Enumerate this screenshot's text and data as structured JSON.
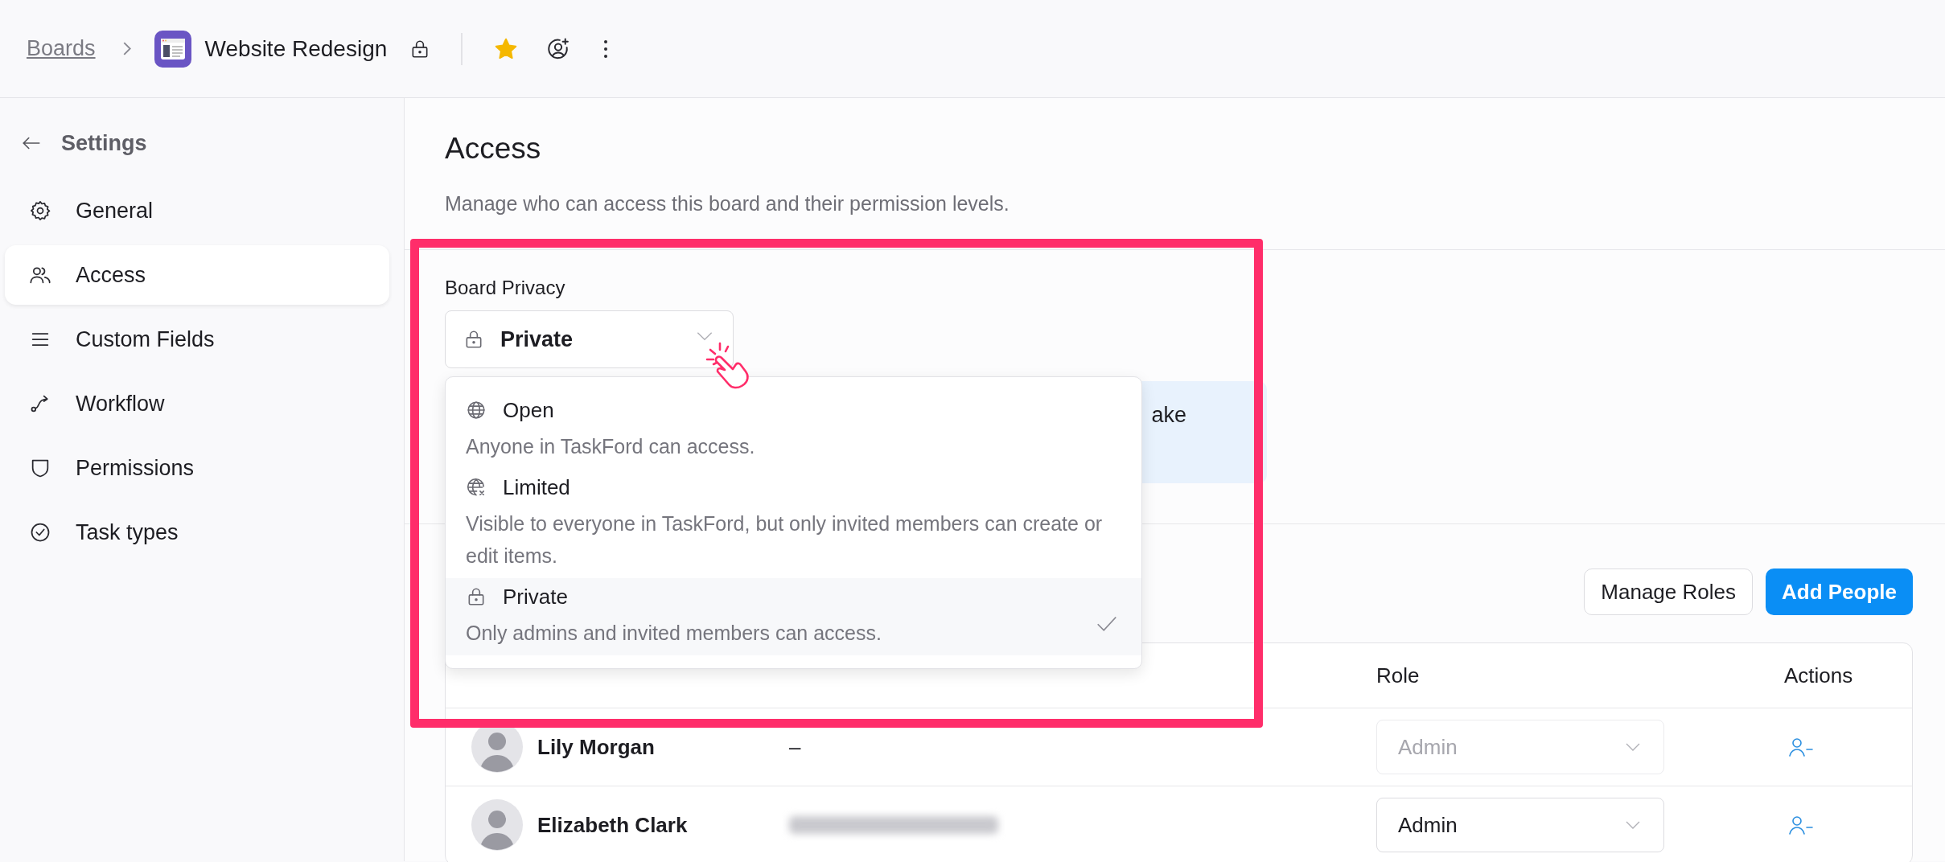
{
  "breadcrumb": {
    "root": "Boards",
    "board": "Website Redesign",
    "favorite": true
  },
  "sidebar": {
    "back": "Settings",
    "items": [
      {
        "label": "General",
        "selected": false
      },
      {
        "label": "Access",
        "selected": true
      },
      {
        "label": "Custom Fields",
        "selected": false
      },
      {
        "label": "Workflow",
        "selected": false
      },
      {
        "label": "Permissions",
        "selected": false
      },
      {
        "label": "Task types",
        "selected": false
      }
    ]
  },
  "page": {
    "title": "Access",
    "subtitle": "Manage who can access this board and their permission levels."
  },
  "privacy": {
    "label": "Board Privacy",
    "value": "Private",
    "banner_text": "ake",
    "options": [
      {
        "title": "Open",
        "description": "Anyone in TaskFord can access.",
        "selected": false
      },
      {
        "title": "Limited",
        "description": "Visible to everyone in TaskFord, but only invited members can create or edit items.",
        "selected": false
      },
      {
        "title": "Private",
        "description": "Only admins and invited members can access.",
        "selected": true
      }
    ]
  },
  "people": {
    "buttons": [
      {
        "label": "Manage Roles",
        "kind": "secondary"
      },
      {
        "label": "Add People",
        "kind": "primary"
      }
    ],
    "columns": [
      "Role",
      "Actions"
    ],
    "rows": [
      {
        "name": "Lily Morgan",
        "email": "–",
        "role": "Admin",
        "role_disabled": true
      },
      {
        "name": "Elizabeth Clark",
        "email_blurred": true,
        "role": "Admin",
        "role_disabled": false
      }
    ]
  }
}
